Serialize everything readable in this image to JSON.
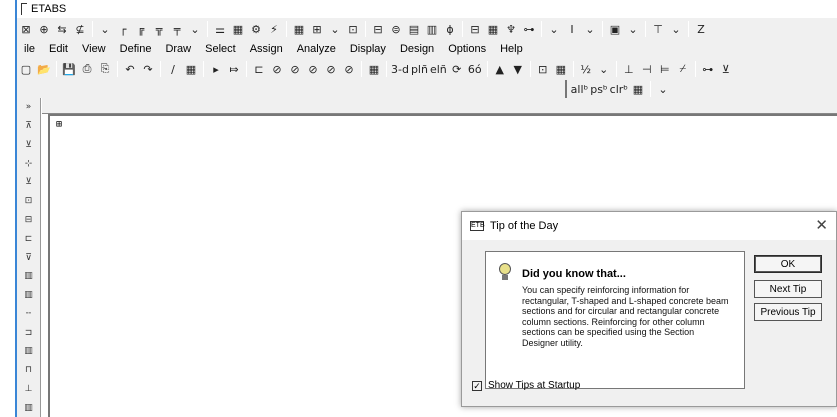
{
  "window": {
    "title": "ETABS"
  },
  "toolbar1": {
    "buttons": [
      "⊠",
      "⊕",
      "⇆",
      "⊈",
      "⌄",
      "┌",
      "╔",
      "╦",
      "╤",
      "⌄",
      "⚌",
      "▦",
      "⚙",
      "⚡",
      "▦",
      "⊞",
      "⌄",
      "⊡",
      "⊟",
      "⊜",
      "▤",
      "▥",
      "ɸ",
      "⊟",
      "▦",
      "♆",
      "⊶",
      "⌄",
      "I",
      "⌄",
      "▣",
      "⌄",
      "⊤",
      "⌄",
      "Z"
    ]
  },
  "menu": {
    "items": [
      {
        "label": "ile"
      },
      {
        "label": "Edit"
      },
      {
        "label": "View"
      },
      {
        "label": "Define"
      },
      {
        "label": "Draw"
      },
      {
        "label": "Select"
      },
      {
        "label": "Assign"
      },
      {
        "label": "Analyze"
      },
      {
        "label": "Display"
      },
      {
        "label": "Design"
      },
      {
        "label": "Options"
      },
      {
        "label": "Help"
      }
    ]
  },
  "toolbar2": {
    "buttons": [
      "▢",
      "📂",
      "💾",
      "⎙",
      "⎘",
      "↶",
      "↷",
      "∕",
      "▦",
      "▸",
      "⤇",
      "⊏",
      "⊘",
      "⊘",
      "⊘",
      "⊘",
      "⊘",
      "▦",
      "3-d",
      "plñ",
      "elñ",
      "⟳",
      "6ó",
      "▲",
      "▼",
      "⊡",
      "▦",
      "½",
      "⌄",
      "⊥",
      "⊣",
      "⊨",
      "⌿",
      "⊶",
      "⊻"
    ]
  },
  "toolbar3": {
    "buttons": [
      "allᵇ",
      "psᵇ",
      "clrᵇ",
      "▦",
      "⌄"
    ]
  },
  "left_toolbar": {
    "buttons": [
      "»",
      "⊼",
      "⊻",
      "⊹",
      "⊻",
      "⊡",
      "⊟",
      "⊏",
      "⊽",
      "▥",
      "▥",
      "╌",
      "⊐",
      "▥",
      "⊓",
      "⊥",
      "▥"
    ]
  },
  "child_window": {
    "title": "⊞"
  },
  "dialog": {
    "title": "Tip of the Day",
    "heading": "Did you know that...",
    "tip": "You can specify reinforcing information for rectangular, T-shaped and L-shaped concrete beam sections and for circular and rectangular concrete column sections. Reinforcing for other column sections can be specified using the Section Designer utility.",
    "ok_label": "OK",
    "next_label": "Next Tip",
    "prev_label": "Previous Tip",
    "show_tips_label": "Show Tips at Startup",
    "show_tips_checked": true
  },
  "colors": {
    "window_edge": "#3a86d6",
    "chrome": "#f0f0f0"
  }
}
